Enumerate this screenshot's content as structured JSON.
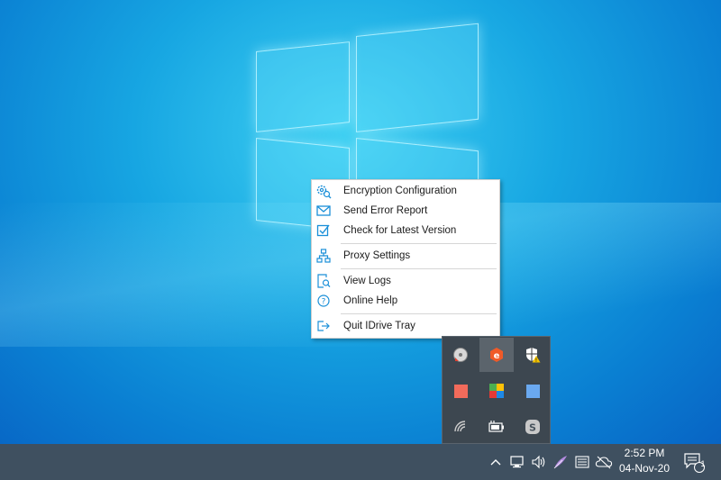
{
  "context_menu": {
    "items": [
      {
        "label": "Encryption Configuration",
        "icon": "encryption-gear-icon"
      },
      {
        "label": "Send Error Report",
        "icon": "envelope-icon"
      },
      {
        "label": "Check for Latest Version",
        "icon": "check-square-icon"
      },
      {
        "label": "Proxy Settings",
        "icon": "network-icon"
      },
      {
        "label": "View Logs",
        "icon": "log-search-icon"
      },
      {
        "label": "Online Help",
        "icon": "help-circle-icon"
      },
      {
        "label": "Quit IDrive Tray",
        "icon": "exit-icon"
      }
    ]
  },
  "tray_overflow": {
    "icons": [
      "disk-utility-icon",
      "idrive-icon",
      "security-warning-icon",
      "red-square-icon",
      "multicolor-app-icon",
      "blue-square-icon",
      "wireless-icon",
      "battery-plug-icon",
      "skype-icon"
    ]
  },
  "taskbar": {
    "time": "2:52 PM",
    "date": "04-Nov-20",
    "notification_count": "1"
  },
  "colors": {
    "accent": "#1a8fd8",
    "idrive_orange": "#f05a28",
    "taskbar": "#3f5060"
  }
}
